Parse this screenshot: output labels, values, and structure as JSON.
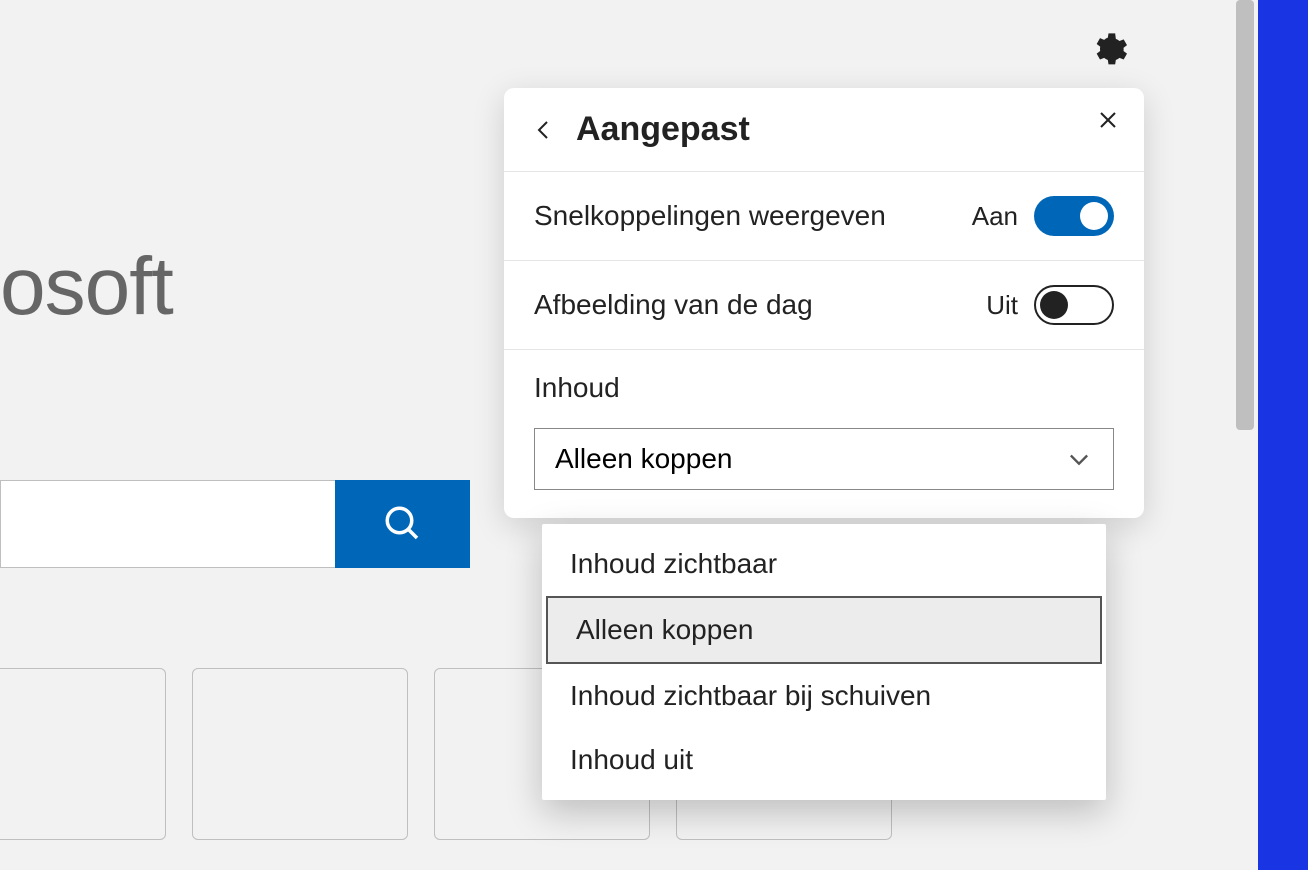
{
  "background": {
    "brand_fragment": "osoft"
  },
  "panel": {
    "title": "Aangepast",
    "shortcuts": {
      "label": "Snelkoppelingen weergeven",
      "state": "Aan"
    },
    "daily_image": {
      "label": "Afbeelding van de dag",
      "state": "Uit"
    },
    "content": {
      "label": "Inhoud",
      "selected": "Alleen koppen",
      "options": [
        "Inhoud zichtbaar",
        "Alleen koppen",
        "Inhoud zichtbaar bij schuiven",
        "Inhoud uit"
      ]
    }
  }
}
